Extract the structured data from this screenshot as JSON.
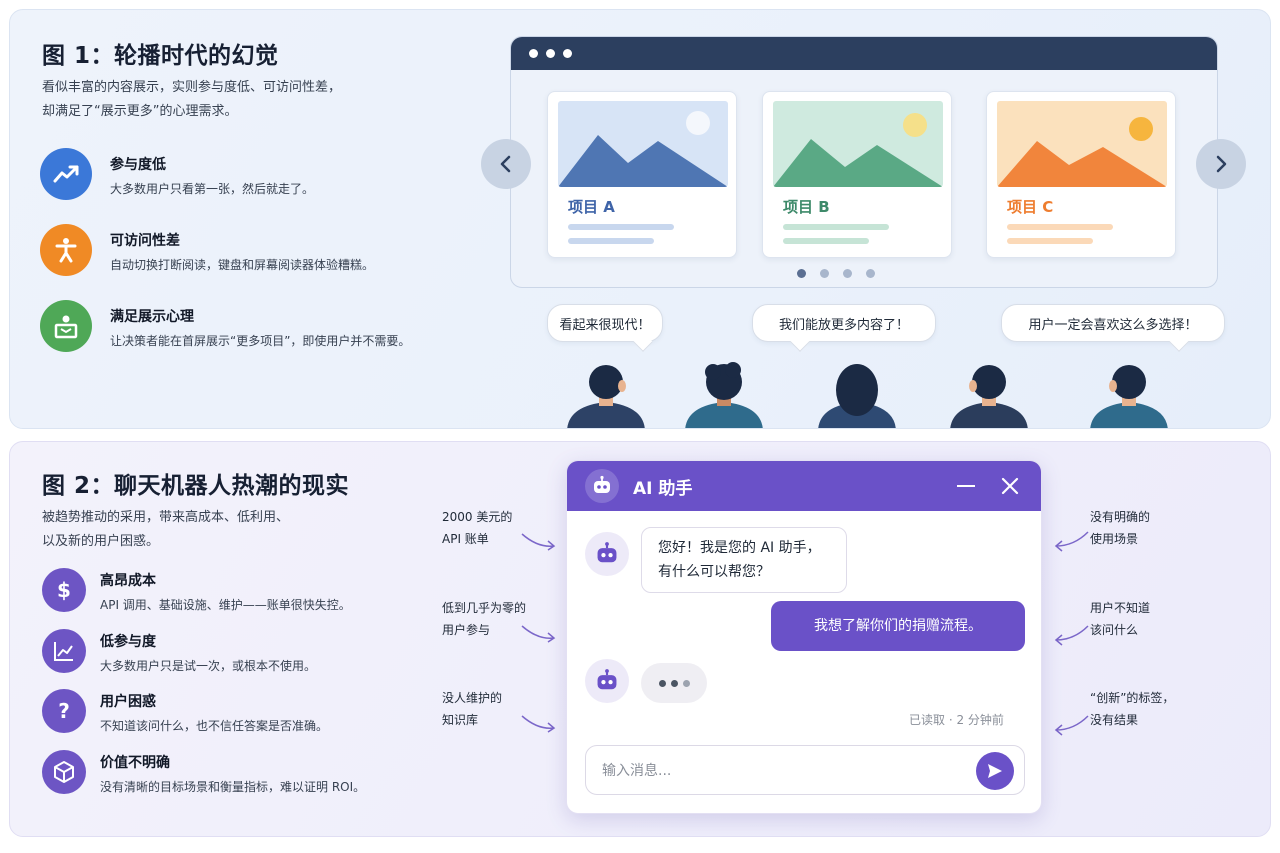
{
  "figure1": {
    "title": "图 1：轮播时代的幻觉",
    "subtitle_line1": "看似丰富的内容展示，实则参与度低、可访问性差，",
    "subtitle_line2": "却满足了“展示更多”的心理需求。",
    "features": [
      {
        "title": "参与度低",
        "desc": "大多数用户只看第一张，然后就走了。",
        "icon": "trend-up-icon",
        "color": "#3b78d8"
      },
      {
        "title": "可访问性差",
        "desc": "自动切换打断阅读，键盘和屏幕阅读器体验糟糕。",
        "icon": "accessibility-icon",
        "color": "#f08a25"
      },
      {
        "title": "满足展示心理",
        "desc": "让决策者能在首屏展示“更多项目”，即使用户并不需要。",
        "icon": "presenter-icon",
        "color": "#4fa857"
      }
    ],
    "carousel": {
      "cards": [
        {
          "label": "项目 A",
          "color": "#3f64a8"
        },
        {
          "label": "项目 B",
          "color": "#3e8a6a"
        },
        {
          "label": "项目 C",
          "color": "#ee7d2f"
        }
      ],
      "pages": 4,
      "active_page": 0
    },
    "bubbles": [
      "看起来很现代！",
      "我们能放更多内容了！",
      "用户一定会喜欢这么多选择！"
    ]
  },
  "figure2": {
    "title": "图 2：聊天机器人热潮的现实",
    "subtitle_line1": "被趋势推动的采用，带来高成本、低利用、",
    "subtitle_line2": "以及新的用户困惑。",
    "features": [
      {
        "title": "高昂成本",
        "desc": "API 调用、基础设施、维护——账单很快失控。",
        "icon": "dollar-icon"
      },
      {
        "title": "低参与度",
        "desc": "大多数用户只是试一次，或根本不使用。",
        "icon": "chart-icon"
      },
      {
        "title": "用户困惑",
        "desc": "不知道该问什么，也不信任答案是否准确。",
        "icon": "question-icon"
      },
      {
        "title": "价值不明确",
        "desc": "没有清晰的目标场景和衡量指标，难以证明 ROI。",
        "icon": "cube-icon"
      }
    ],
    "chat": {
      "title": "AI 助手",
      "bot_msg_line1": "您好！我是您的 AI 助手，",
      "bot_msg_line2": "有什么可以帮您？",
      "user_msg": "我想了解你们的捐赠流程。",
      "read_status": "已读取 · 2 分钟前",
      "input_placeholder": "输入消息..."
    },
    "left_notes": [
      {
        "line1": "2000 美元的",
        "line2": "API 账单"
      },
      {
        "line1": "低到几乎为零的",
        "line2": "用户参与"
      },
      {
        "line1": "没人维护的",
        "line2": "知识库"
      }
    ],
    "right_notes": [
      {
        "line1": "没有明确的",
        "line2": "使用场景"
      },
      {
        "line1": "用户不知道",
        "line2": "该问什么"
      },
      {
        "line1": "“创新”的标签，",
        "line2": "没有结果"
      }
    ],
    "accent": "#6a51c8"
  }
}
